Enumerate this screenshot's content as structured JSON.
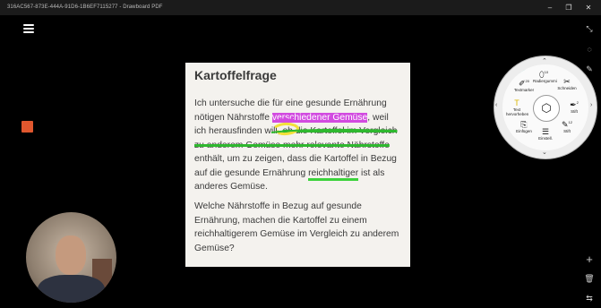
{
  "window": {
    "title": "316AC567-873E-444A-91D6-1B6EF7115277 - Drawboard PDF",
    "minimize": "–",
    "maximize": "❐",
    "close": "✕"
  },
  "document": {
    "heading": "Kartoffelfrage",
    "paragraph1": [
      "Ich untersuche die für eine gesunde Ernährung",
      [
        "nötigen Nährstoffe ",
        "verschiedener Gemüse",
        ", weil"
      ],
      [
        "ich herausfinden will, ",
        "ob die Kartoffel im Vergleich",
        ""
      ],
      [
        "",
        "zu anderem Gemüse mehr relevante Nährstoffe",
        ""
      ],
      "enthält, um zu zeigen, dass die Kartoffel in Bezug",
      [
        "auf die gesunde Ernährung ",
        "reichhaltiger",
        " ist als"
      ],
      "anderes Gemüse."
    ],
    "paragraph2": [
      "Welche Nährstoffe in Bezug auf gesunde",
      "Ernährung, machen die Kartoffel zu einem",
      "reichhaltigerem Gemüse im Vergleich zu anderem",
      "Gemüse?"
    ]
  },
  "colors": {
    "pink_highlight": "#d24be0",
    "green_pen": "#2fb82f",
    "yellow_highlight": "#f3e03a",
    "record": "#e0572e",
    "ring_accent": "#26a7a0"
  },
  "radial_menu": {
    "tools": {
      "radiergummi": {
        "label": "Radiergummi",
        "badge": "10"
      },
      "schneiden": {
        "label": "Schneiden"
      },
      "stift_right": {
        "label": "Stift",
        "badge": "2"
      },
      "stift_bottom": {
        "label": "Stift",
        "badge": "12"
      },
      "einstell": {
        "label": "Einstell."
      },
      "einfugen": {
        "label": "Einfügen"
      },
      "text_hervorheben": {
        "label": "Text hervorheben"
      },
      "textmarker": {
        "label": "Textmarker",
        "badge": "20"
      }
    },
    "hub_icon": "hexagon-nut-icon"
  },
  "right_toolbar": [
    "magic-pen-icon",
    "lasso-icon",
    "pen-icon",
    "zoom-in-icon",
    "delete-icon",
    "settings-icon"
  ]
}
